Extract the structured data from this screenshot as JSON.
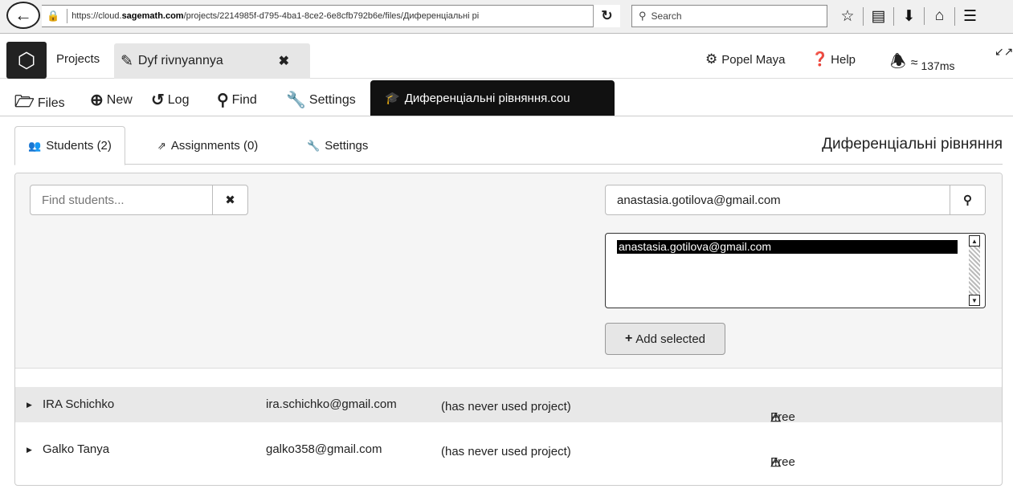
{
  "browser": {
    "url_prefix": "https://cloud.",
    "url_domain": "sagemath.com",
    "url_rest": "/projects/2214985f-d795-4ba1-8ce2-6e8cfb792b6e/files/Диференціальні рі",
    "search_placeholder": "Search"
  },
  "nav": {
    "projects_label": "Projects",
    "project_tab": "Dyf rivnyannya",
    "user": "Popel Maya",
    "help": "Help",
    "ping": "137ms"
  },
  "project_toolbar": {
    "files": "Files",
    "new": "New",
    "log": "Log",
    "find": "Find",
    "settings": "Settings",
    "open_file_tab": "Диференціальні рівняння.cou"
  },
  "course": {
    "tabs": [
      {
        "label": "Students (2)"
      },
      {
        "label": "Assignments (0)"
      },
      {
        "label": "Settings"
      }
    ],
    "title": "Диференціальні рівняння",
    "find_students_placeholder": "Find students...",
    "add_email_value": "anastasia.gotilova@gmail.com",
    "search_results": [
      "anastasia.gotilova@gmail.com"
    ],
    "add_selected_label": "Add selected",
    "students": [
      {
        "name": "IRA Schichko",
        "email": "ira.schichko@gmail.com",
        "status": "(has never used project)",
        "plan": "Free"
      },
      {
        "name": "Galko Tanya",
        "email": "galko358@gmail.com",
        "status": "(has never used project)",
        "plan": "Free"
      }
    ]
  }
}
